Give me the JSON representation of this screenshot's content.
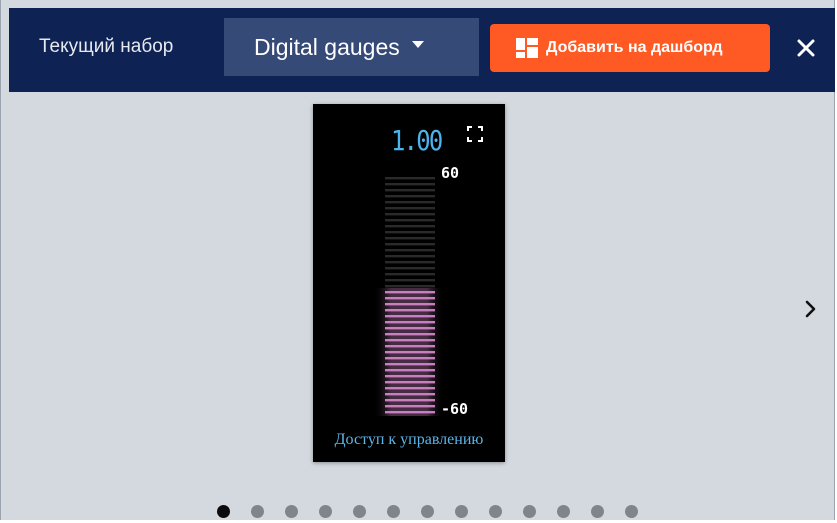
{
  "header": {
    "set_label": "Текущий набор",
    "set_value": "Digital gauges",
    "add_button_label": "Добавить на дашборд",
    "add_button_icon": "dashboard-icon",
    "close_icon": "close-icon"
  },
  "widget": {
    "value": "1.00",
    "scale_max": "60",
    "scale_min": "-60",
    "fill_fraction": 0.52,
    "access_link": "Доступ к управлению",
    "fullscreen_icon": "fullscreen-icon",
    "bar_color": "#c77fbf",
    "readout_color": "#4cb4ec"
  },
  "carousel": {
    "next_icon": "chevron-right-icon",
    "dot_count": 13,
    "active_dot": 0
  },
  "colors": {
    "header_bg": "#0e2254",
    "select_bg": "#364a78",
    "accent": "#ff5a24",
    "page_bg": "#d3d9de"
  }
}
